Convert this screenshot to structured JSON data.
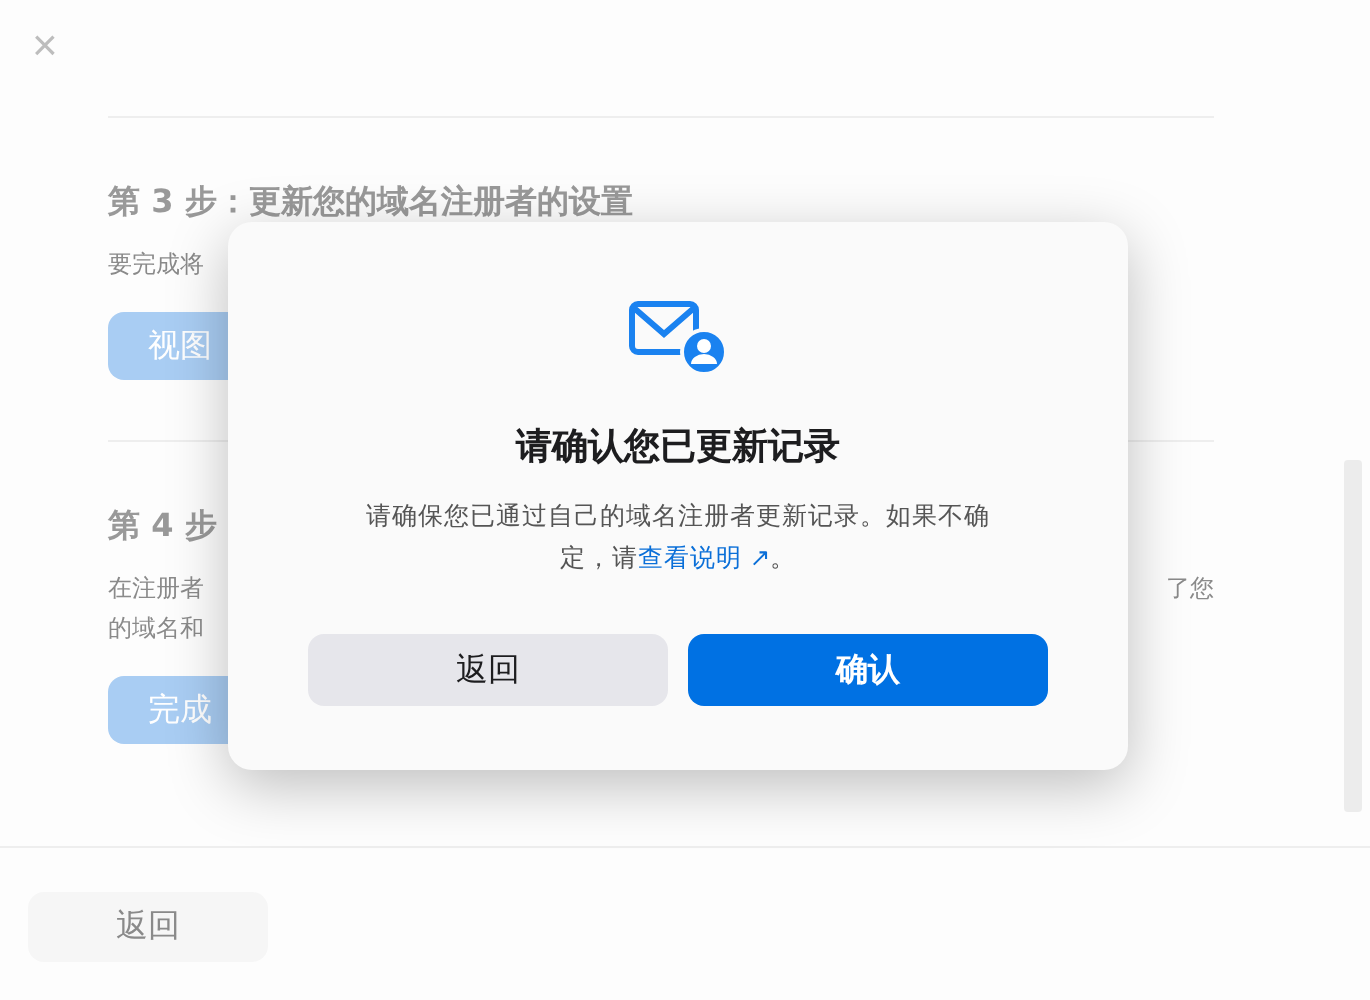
{
  "background": {
    "close": "×",
    "steps": [
      {
        "title": "第 3 步：更新您的域名注册者的设置",
        "lines": [
          {
            "left": "要完成将"
          }
        ],
        "button": "视图"
      },
      {
        "title": "第 4 步",
        "lines": [
          {
            "left": "在注册者",
            "right": "了您"
          },
          {
            "left": "的域名和"
          }
        ],
        "button": "完成"
      }
    ],
    "footer_button": "返回"
  },
  "dialog": {
    "title": "请确认您已更新记录",
    "message": "请确保您已通过自己的域名注册者更新记录。如果不确定，请",
    "link": "查看说明 ↗",
    "message_end": "。",
    "buttons": [
      {
        "label": "返回",
        "kind": "secondary"
      },
      {
        "label": "确认",
        "kind": "primary"
      }
    ]
  }
}
